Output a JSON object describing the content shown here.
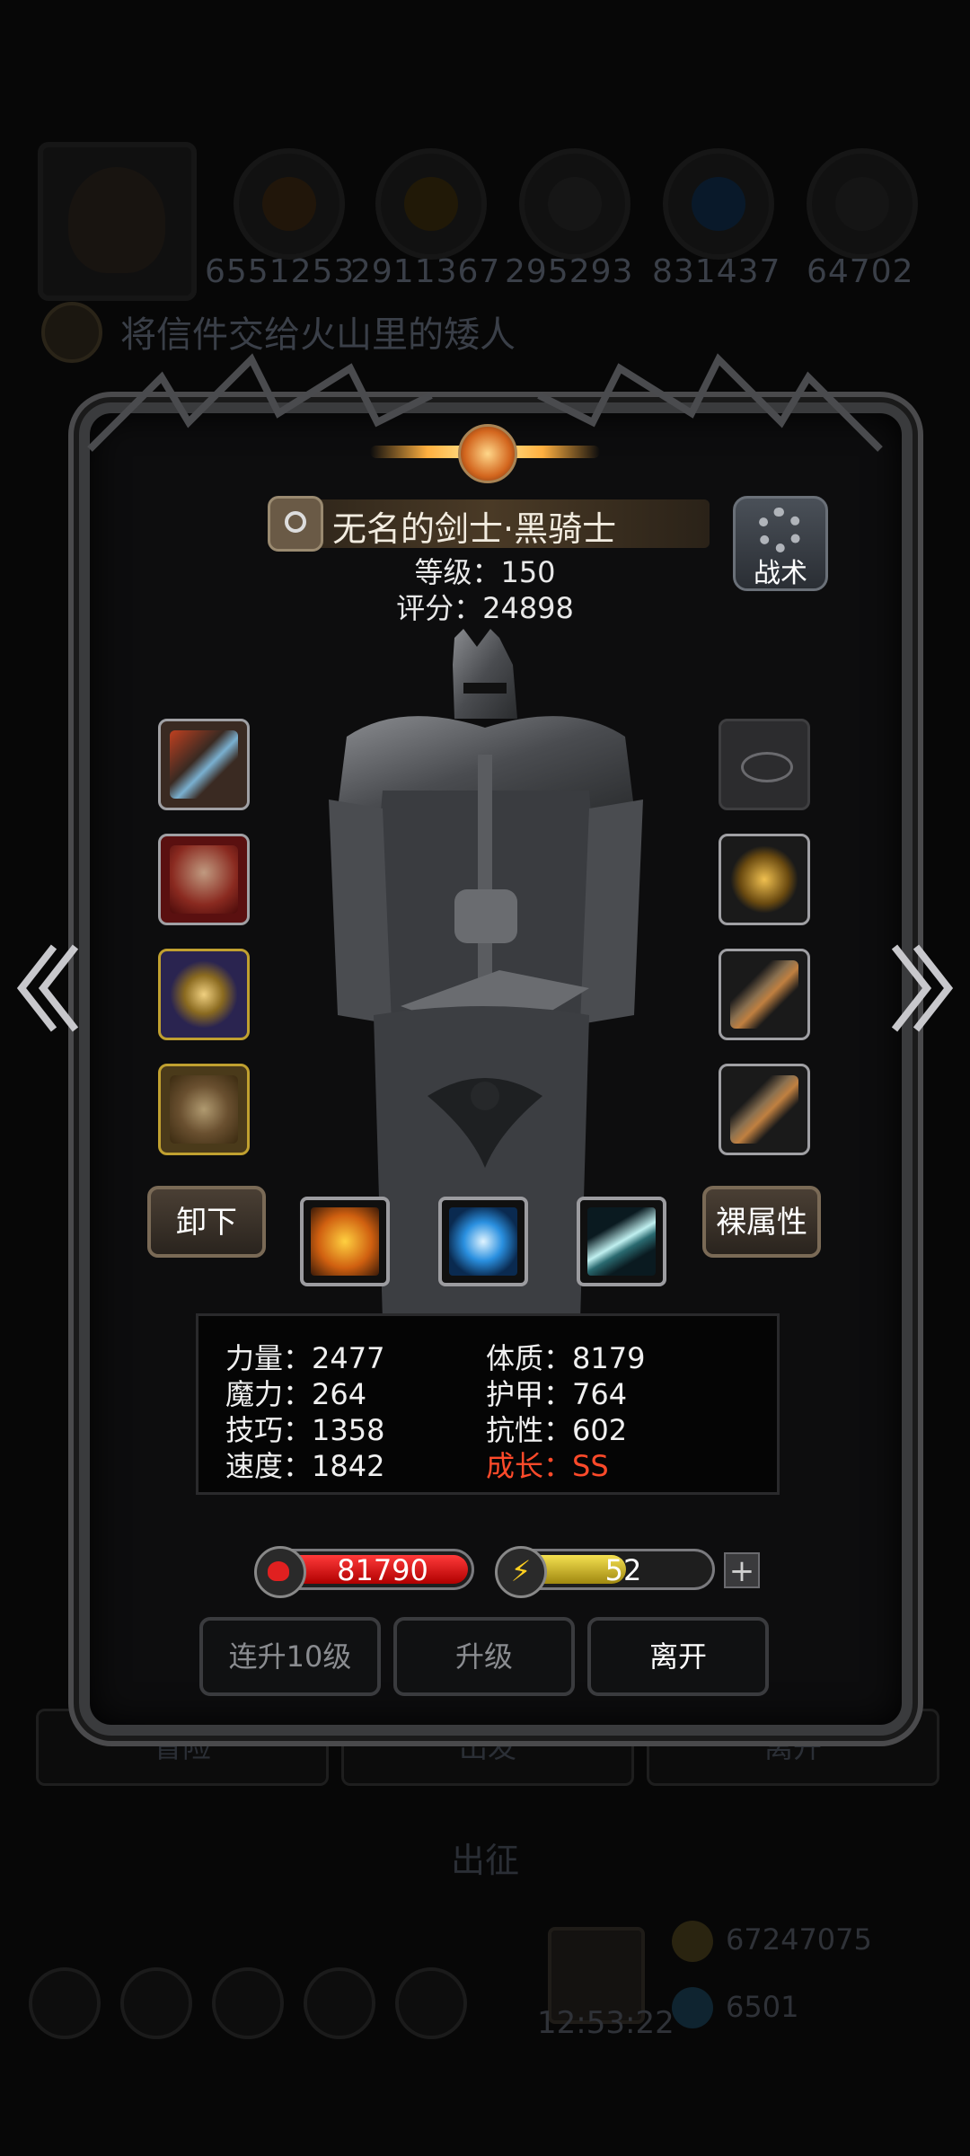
{
  "background": {
    "resources": [
      "6551253",
      "2911367",
      "295293",
      "831437",
      "64702"
    ],
    "quest_text": "将信件交给火山里的矮人",
    "bottom_buttons": [
      "冒险",
      "出发",
      "离开"
    ],
    "go_label": "出征",
    "timer": "12:53:22",
    "gold": "67247075",
    "gems": "6501"
  },
  "hero": {
    "name": "无名的剑士·黑骑士",
    "level": "等级：150",
    "score": "评分：24898",
    "tactic_label": "战术"
  },
  "buttons": {
    "unequip": "卸下",
    "base_attributes": "裸属性",
    "level_up_10": "连升10级",
    "level_up": "升级",
    "leave": "离开"
  },
  "stats": {
    "strength": "力量：2477",
    "magic": "魔力：264",
    "skill": "技巧：1358",
    "speed": "速度：1842",
    "constitution": "体质：8179",
    "armor": "护甲：764",
    "resistance": "抗性：602",
    "growth": "成长：SS"
  },
  "bars": {
    "hp": "81790",
    "hp_fill": 1.0,
    "energy": "52",
    "energy_fill": 0.6,
    "plus": "+"
  },
  "colors": {
    "growth": "#ff4a2a",
    "hp": "#d01010",
    "energy": "#e0c830"
  },
  "icons": [
    "sword-icon",
    "chest-armor-icon",
    "amulet-icon",
    "compass-icon",
    "ring-icon",
    "helm-charm-icon",
    "gauntlet-icon",
    "shield-skill-icon",
    "eye-skill-icon",
    "slash-skill-icon",
    "gear-icon",
    "heart-icon",
    "lightning-icon"
  ]
}
